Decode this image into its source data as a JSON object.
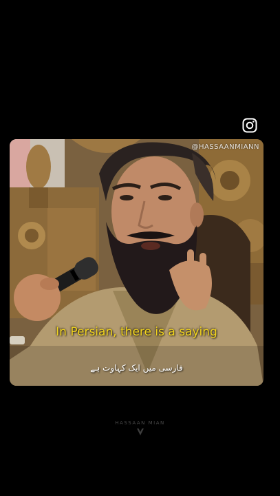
{
  "header": {
    "instagram_icon": "instagram-icon"
  },
  "video": {
    "handle": "@HASSAANMIANN",
    "caption": "In Persian, there is a saying",
    "subcaption": "فارسی میں ایک کہاوت ہے"
  },
  "footer": {
    "brand_name": "HASSAAN MIAN",
    "brand_logo_icon": "brand-logo-icon"
  },
  "colors": {
    "background": "#000000",
    "caption": "#f2d41e",
    "subcaption": "#ffffff"
  }
}
